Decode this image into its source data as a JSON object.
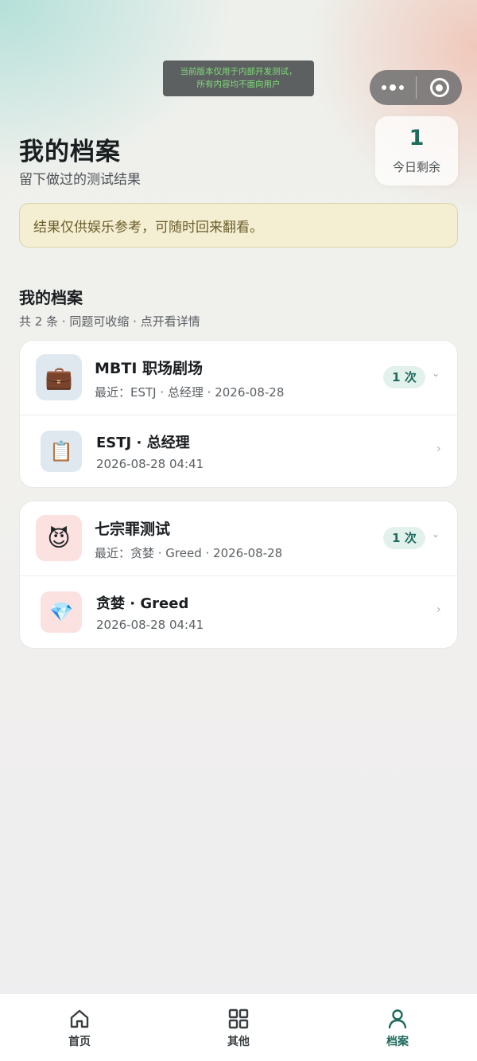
{
  "dev_banner": {
    "line1": "当前版本仅用于内部开发测试，",
    "line2": "所有内容均不面向用户"
  },
  "header": {
    "title": "我的档案",
    "subtitle": "留下做过的测试结果"
  },
  "remaining": {
    "count": "1",
    "label": "今日剩余"
  },
  "notice": {
    "text": "结果仅供娱乐参考，可随时回来翻看。"
  },
  "section": {
    "title": "我的档案",
    "summary": "共 2 条 · 同题可收缩 · 点开看详情"
  },
  "groups": [
    {
      "icon": "briefcase-icon",
      "icon_glyph": "💼",
      "title": "MBTI 职场剧场",
      "recent": "最近：ESTJ · 总经理 · 2026-08-28",
      "count": "1 次",
      "records": [
        {
          "icon": "clipboard-icon",
          "icon_glyph": "📋",
          "title": "ESTJ · 总经理",
          "time": "2026-08-28 04:41"
        }
      ]
    },
    {
      "icon": "devil-icon",
      "icon_glyph": "😈",
      "title": "七宗罪测试",
      "recent": "最近：贪婪 · Greed · 2026-08-28",
      "count": "1 次",
      "records": [
        {
          "icon": "gem-icon",
          "icon_glyph": "💎",
          "title": "贪婪 · Greed",
          "time": "2026-08-28 04:41"
        }
      ]
    }
  ],
  "tabbar": {
    "items": [
      {
        "label": "首页",
        "icon": "home-icon",
        "active": false
      },
      {
        "label": "其他",
        "icon": "grid-icon",
        "active": false
      },
      {
        "label": "档案",
        "icon": "user-icon",
        "active": true
      }
    ]
  },
  "colors": {
    "accent": "#1e6a5c",
    "notice_bg": "#f4efd2",
    "notice_text": "#6b5e2c"
  }
}
